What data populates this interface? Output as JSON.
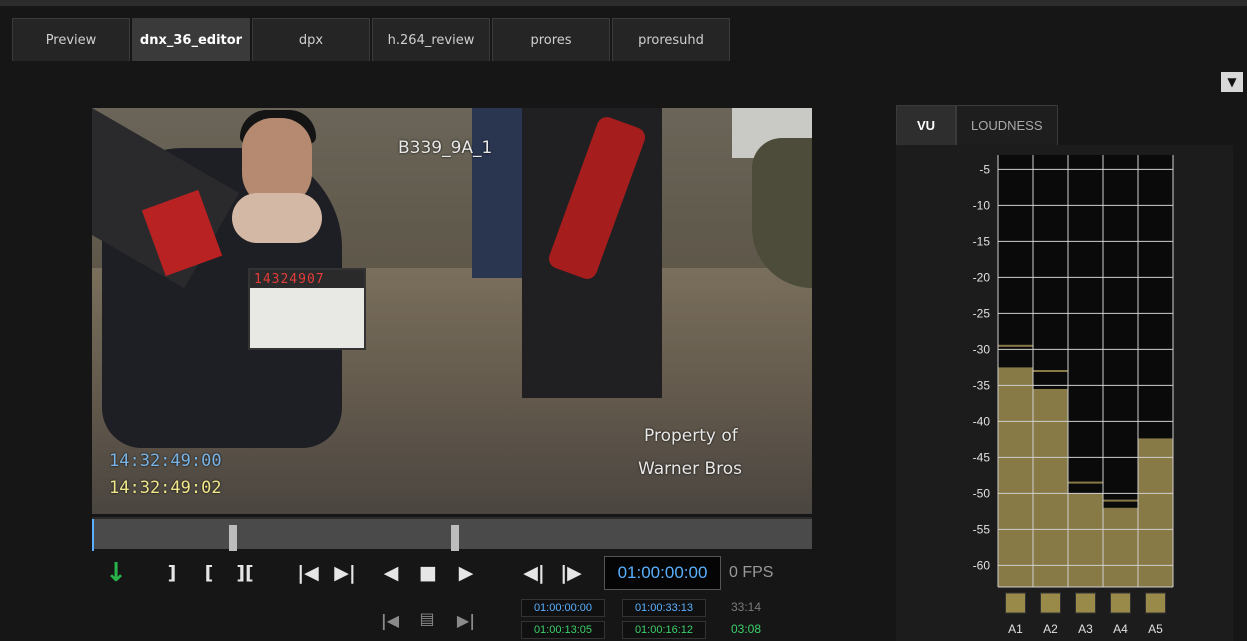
{
  "tabs": [
    {
      "label": "Preview",
      "active": false
    },
    {
      "label": "dnx_36_editor",
      "active": true
    },
    {
      "label": "dpx",
      "active": false
    },
    {
      "label": "h.264_review",
      "active": false
    },
    {
      "label": "prores",
      "active": false
    },
    {
      "label": "proresuhd",
      "active": false
    }
  ],
  "dropdown_icon": "▼",
  "video": {
    "clip_name": "B339_9A_1",
    "watermark_line1": "Property of",
    "watermark_line2": "Warner Bros",
    "timecode_source": "14:32:49:00",
    "timecode_aux": "14:32:49:02",
    "slate_digits": "14324907"
  },
  "transport": {
    "timecode": "01:00:00:00",
    "fps": "0 FPS",
    "mark_in": "01:00:00:00",
    "mark_out": "01:00:33:13",
    "duration": "33:14",
    "sel_in": "01:00:13:05",
    "sel_out": "01:00:16:12",
    "sel_duration": "03:08"
  },
  "meter": {
    "tabs": [
      "VU",
      "LOUDNESS"
    ],
    "scale": [
      "-5",
      "-10",
      "-15",
      "-20",
      "-25",
      "-30",
      "-35",
      "-40",
      "-45",
      "-50",
      "-55",
      "-60"
    ],
    "channels": [
      {
        "name": "A1",
        "level_db": -32.5,
        "peak_db": -29.5
      },
      {
        "name": "A2",
        "level_db": -35.5,
        "peak_db": -33.0
      },
      {
        "name": "A3",
        "level_db": -50.0,
        "peak_db": -48.5
      },
      {
        "name": "A4",
        "level_db": -52.0,
        "peak_db": -51.0
      },
      {
        "name": "A5",
        "level_db": -42.5,
        "peak_db": -42.5
      }
    ],
    "colors": {
      "bar": "#877a46",
      "grid": "#d0d0d0",
      "background": "#0a0a0a",
      "channel_button": "#9a8a4a"
    }
  }
}
